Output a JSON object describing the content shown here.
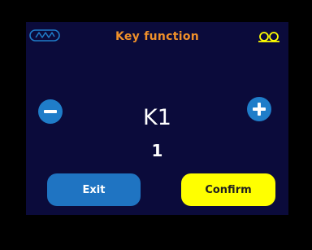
{
  "header": {
    "title": "Key function",
    "left_icon": "wave-signal-icon",
    "right_icon": "tape-reel-icon",
    "left_icon_color": "#1f7dc9",
    "right_icon_color": "#ffff00"
  },
  "selector": {
    "name": "K1",
    "value": "1",
    "decrement_icon": "minus-icon",
    "increment_icon": "plus-icon"
  },
  "buttons": {
    "exit_label": "Exit",
    "confirm_label": "Confirm"
  },
  "colors": {
    "screen_background": "#0b0b3b",
    "title": "#f0902a",
    "primary_button": "#1f74c2",
    "confirm_button": "#ffff00"
  }
}
